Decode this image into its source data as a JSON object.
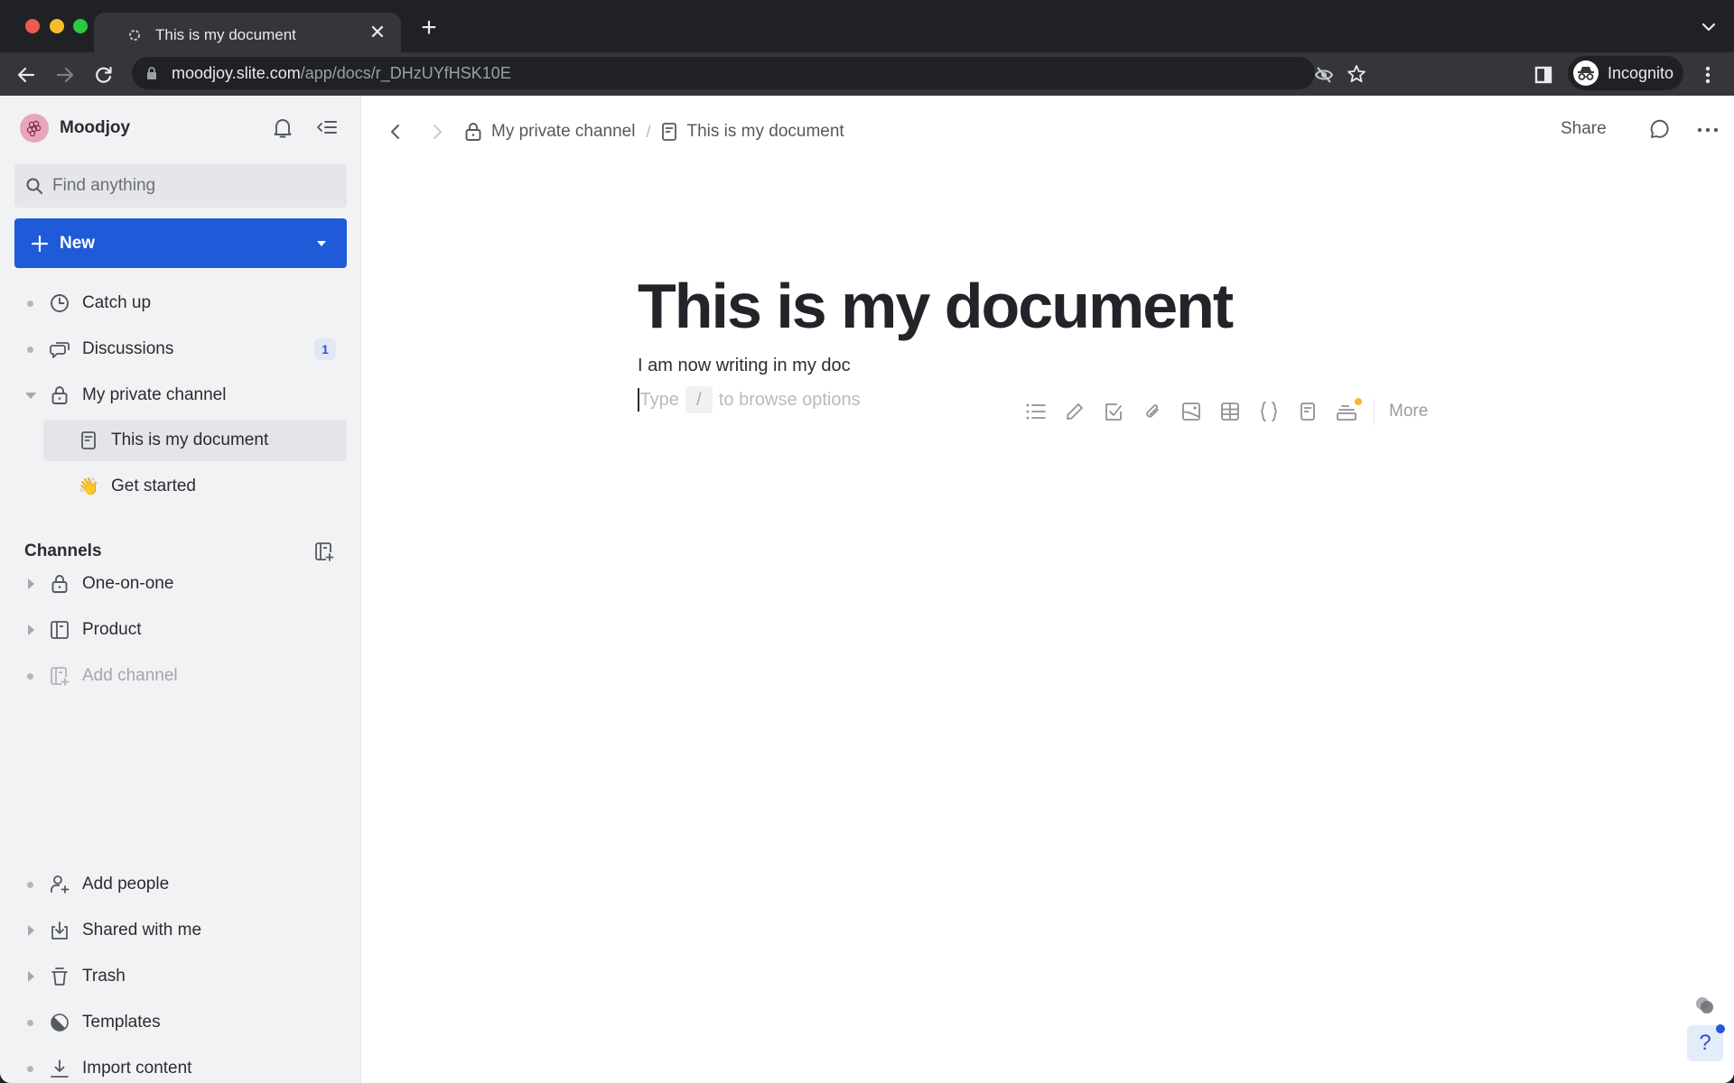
{
  "browser": {
    "tab_title": "This is my document",
    "new_tab_label": "+",
    "url_host": "moodjoy.slite.com",
    "url_path": "/app/docs/r_DHzUYfHSK10E",
    "profile_label": "Incognito"
  },
  "sidebar": {
    "workspace_name": "Moodjoy",
    "search_placeholder": "Find anything",
    "new_button_label": "New",
    "items": [
      {
        "label": "Catch up",
        "icon": "clock-icon"
      },
      {
        "label": "Discussions",
        "icon": "chat-icon",
        "badge": "1"
      },
      {
        "label": "My private channel",
        "icon": "lock-icon",
        "expanded": true
      },
      {
        "label": "This is my document",
        "icon": "document-icon",
        "selected": true
      },
      {
        "label": "Get started",
        "icon": "waving-hand-icon",
        "emoji": "👋"
      }
    ],
    "channels_heading": "Channels",
    "channels": [
      {
        "label": "One-on-one",
        "icon": "lock-icon"
      },
      {
        "label": "Product",
        "icon": "channel-icon"
      },
      {
        "label": "Add channel",
        "icon": "add-channel-icon",
        "muted": true
      }
    ],
    "footer_items": [
      {
        "label": "Add people",
        "icon": "add-person-icon"
      },
      {
        "label": "Shared with me",
        "icon": "inbox-download-icon"
      },
      {
        "label": "Trash",
        "icon": "trash-icon"
      },
      {
        "label": "Templates",
        "icon": "templates-icon"
      },
      {
        "label": "Import content",
        "icon": "import-icon"
      }
    ]
  },
  "topbar": {
    "breadcrumb": [
      {
        "label": "My private channel",
        "icon": "lock-icon"
      },
      {
        "label": "This is my document",
        "icon": "document-icon"
      }
    ],
    "breadcrumb_separator": "/",
    "share_label": "Share"
  },
  "document": {
    "title": "This is my document",
    "paragraph": "I am now writing in my doc",
    "placeholder_before": "Type",
    "placeholder_key": "/",
    "placeholder_after": "to browse options",
    "insert_toolbar": [
      "bullet-list-icon",
      "pencil-icon",
      "checkbox-icon",
      "attachment-icon",
      "image-icon",
      "table-icon",
      "code-braces-icon",
      "document-icon",
      "embed-stack-icon"
    ],
    "insert_more_label": "More"
  },
  "help": {
    "label": "?"
  },
  "colors": {
    "accent": "#1f5bd9",
    "sidebar_bg": "#f1f2f4",
    "badge_bg": "#e2e7f6",
    "new_dot": "#f5b733"
  }
}
